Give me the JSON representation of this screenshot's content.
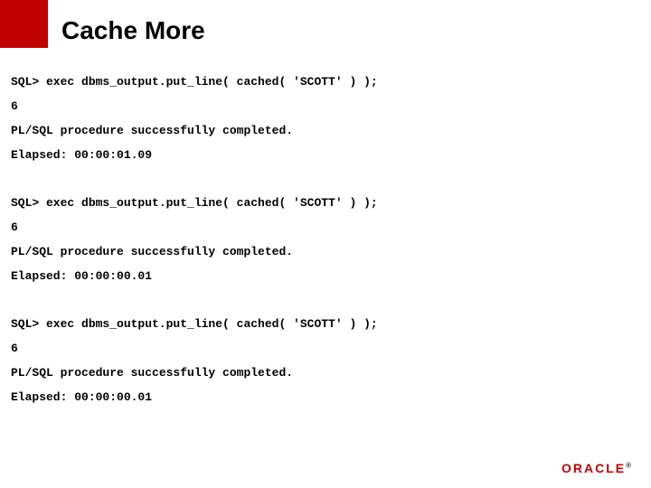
{
  "title": "Cache More",
  "blocks": [
    {
      "lines": [
        "SQL> exec dbms_output.put_line( cached( 'SCOTT' ) );",
        "6",
        "PL/SQL procedure successfully completed.",
        "Elapsed: 00:00:01.09"
      ]
    },
    {
      "lines": [
        "SQL> exec dbms_output.put_line( cached( 'SCOTT' ) );",
        "6",
        "PL/SQL procedure successfully completed.",
        "Elapsed: 00:00:00.01"
      ]
    },
    {
      "lines": [
        "SQL> exec dbms_output.put_line( cached( 'SCOTT' ) );",
        "6",
        "PL/SQL procedure successfully completed.",
        "Elapsed: 00:00:00.01"
      ]
    }
  ],
  "logo": {
    "text": "ORACLE",
    "reg": "®"
  }
}
